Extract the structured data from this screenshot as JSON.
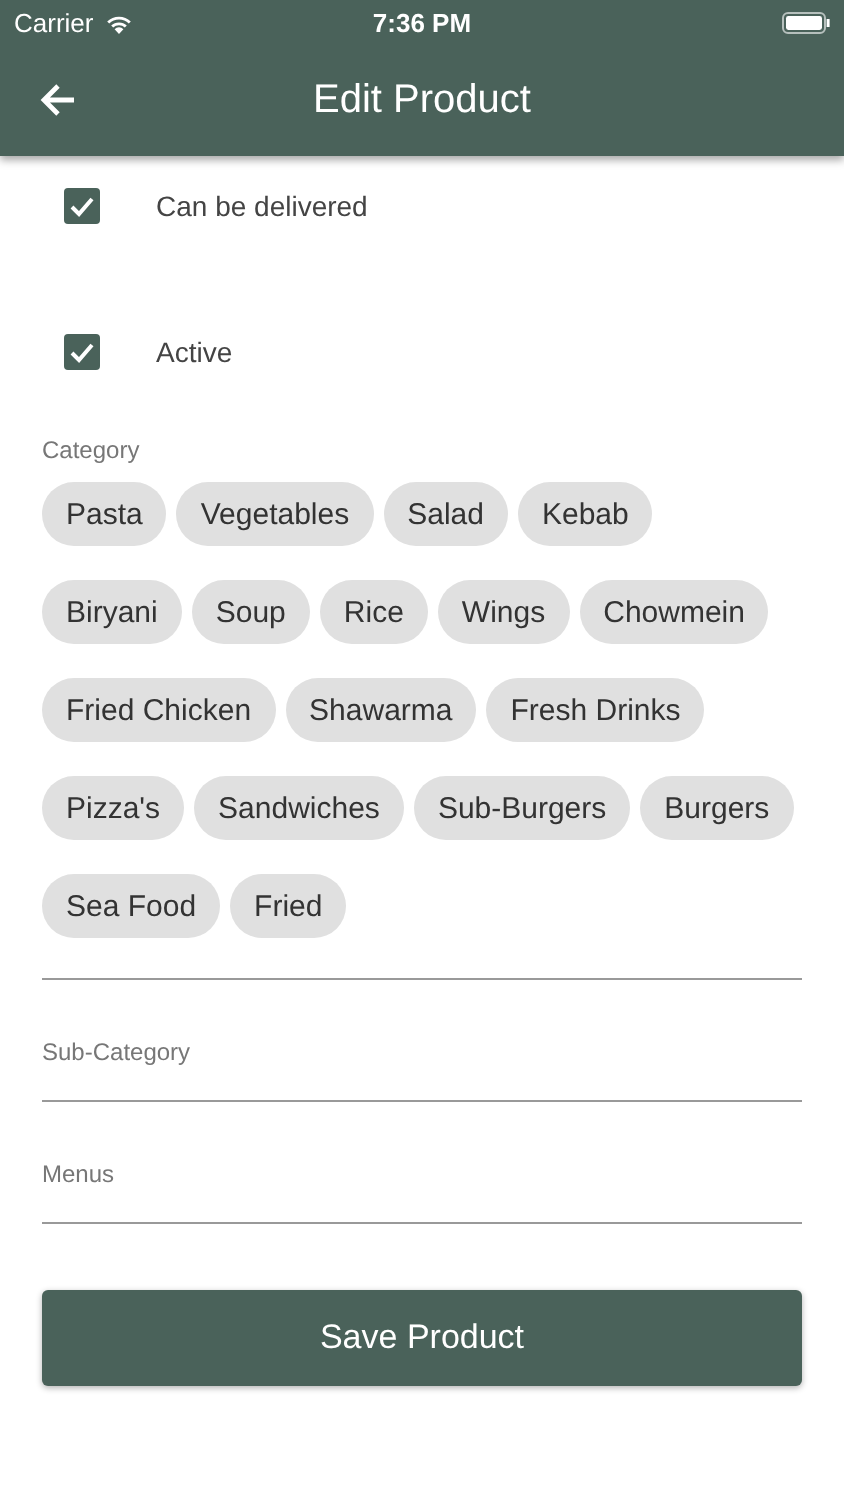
{
  "status_bar": {
    "carrier": "Carrier",
    "time": "7:36 PM"
  },
  "app_bar": {
    "title": "Edit Product"
  },
  "options": [
    {
      "label": "Can be delivered",
      "checked": true
    },
    {
      "label": "Active",
      "checked": true
    }
  ],
  "category": {
    "label": "Category",
    "chip_rows": [
      [
        {
          "label": "Pasta",
          "selected": false
        },
        {
          "label": "Vegetables",
          "selected": false
        },
        {
          "label": "Salad",
          "selected": false
        },
        {
          "label": "Kebab",
          "selected": false
        }
      ],
      [
        {
          "label": "Biryani",
          "selected": false
        },
        {
          "label": "Soup",
          "selected": false
        },
        {
          "label": "Rice",
          "selected": false
        },
        {
          "label": "Wings",
          "selected": false
        },
        {
          "label": "Chowmein",
          "selected": false
        }
      ],
      [
        {
          "label": "Fried Chicken",
          "selected": false
        },
        {
          "label": "Shawarma",
          "selected": false
        },
        {
          "label": "Fresh Drinks",
          "selected": false
        }
      ],
      [
        {
          "label": "Pizza's",
          "selected": false
        },
        {
          "label": "Sandwiches",
          "selected": false
        },
        {
          "label": "Sub-Burgers",
          "selected": false
        },
        {
          "label": "Burgers",
          "selected": false
        }
      ],
      [
        {
          "label": "Sea Food",
          "selected": false
        },
        {
          "label": "Fried",
          "selected": false
        }
      ]
    ]
  },
  "fields": [
    {
      "label": "Sub-Category"
    },
    {
      "label": "Menus"
    }
  ],
  "save_button": "Save Product"
}
